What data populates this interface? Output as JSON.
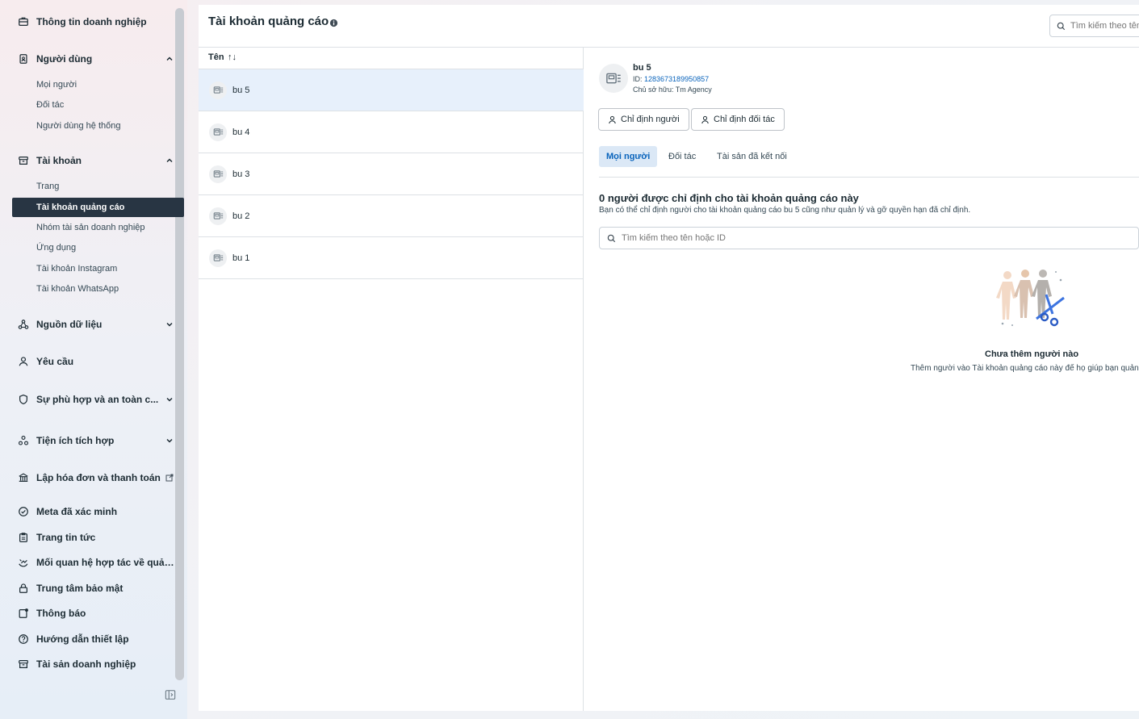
{
  "sidebar": {
    "groups": [
      {
        "label": "Thông tin doanh nghiệp",
        "icon": "briefcase-icon"
      },
      {
        "label": "Người dùng",
        "icon": "badge-icon"
      },
      {
        "label": "Tài khoản",
        "icon": "box-icon"
      },
      {
        "label": "Nguồn dữ liệu",
        "icon": "nodes-icon"
      },
      {
        "label": "Yêu cầu",
        "icon": "person-icon"
      },
      {
        "label": "Sự phù hợp và an toàn c...",
        "icon": "shield-icon"
      },
      {
        "label": "Tiện ích tích hợp",
        "icon": "puzzle-icon"
      },
      {
        "label": "Lập hóa đơn và thanh toán",
        "icon": "bank-icon"
      },
      {
        "label": "Meta đã xác minh",
        "icon": "verified-icon"
      },
      {
        "label": "Trang tin tức",
        "icon": "clipboard-icon"
      },
      {
        "label": "Mối quan hệ hợp tác về quảng ...",
        "icon": "handshake-icon"
      },
      {
        "label": "Trung tâm bảo mật",
        "icon": "lock-icon"
      },
      {
        "label": "Thông báo",
        "icon": "bell-icon"
      },
      {
        "label": "Hướng dẫn thiết lập",
        "icon": "help-icon"
      },
      {
        "label": "Tài sản doanh nghiệp",
        "icon": "archive-icon"
      }
    ],
    "users_sub": [
      "Mọi người",
      "Đối tác",
      "Người dùng hệ thống"
    ],
    "accounts_sub": [
      "Trang",
      "Tài khoản quảng cáo",
      "Nhóm tài sản doanh nghiệp",
      "Ứng dụng",
      "Tài khoản Instagram",
      "Tài khoản WhatsApp"
    ],
    "active_item": "Tài khoản quảng cáo"
  },
  "header": {
    "title": "Tài khoản quảng cáo",
    "search_placeholder": "Tìm kiếm theo tên"
  },
  "list": {
    "column_label": "Tên",
    "sort_glyph": "↑↓",
    "rows": [
      "bu 5",
      "bu 4",
      "bu 3",
      "bu 2",
      "bu 1"
    ],
    "selected": "bu 5"
  },
  "detail": {
    "name": "bu 5",
    "id_prefix": "ID: ",
    "id_value": "1283673189950857",
    "owner": "Chủ sở hữu: Tm Agency",
    "assign_people_button": "Chỉ định người",
    "assign_partner_button": "Chỉ định đối tác",
    "tabs": [
      "Mọi người",
      "Đối tác",
      "Tài sản đã kết nối"
    ],
    "active_tab": "Mọi người",
    "section_title": "0 người được chỉ định cho tài khoản quảng cáo này",
    "section_desc": "Bạn có thể chỉ định người cho tài khoản quảng cáo bu 5 cũng như quản lý và gỡ quyền hạn đã chỉ định.",
    "search_placeholder": "Tìm kiếm theo tên hoặc ID",
    "empty_title": "Chưa thêm người nào",
    "empty_desc": "Thêm người vào Tài khoản quảng cáo này để họ giúp bạn quản lý."
  },
  "colors": {
    "active_nav_bg": "#283543",
    "selected_row_bg": "#e7f0fb",
    "link": "#0a64bc",
    "tab_active_bg": "#dbe8f6"
  }
}
